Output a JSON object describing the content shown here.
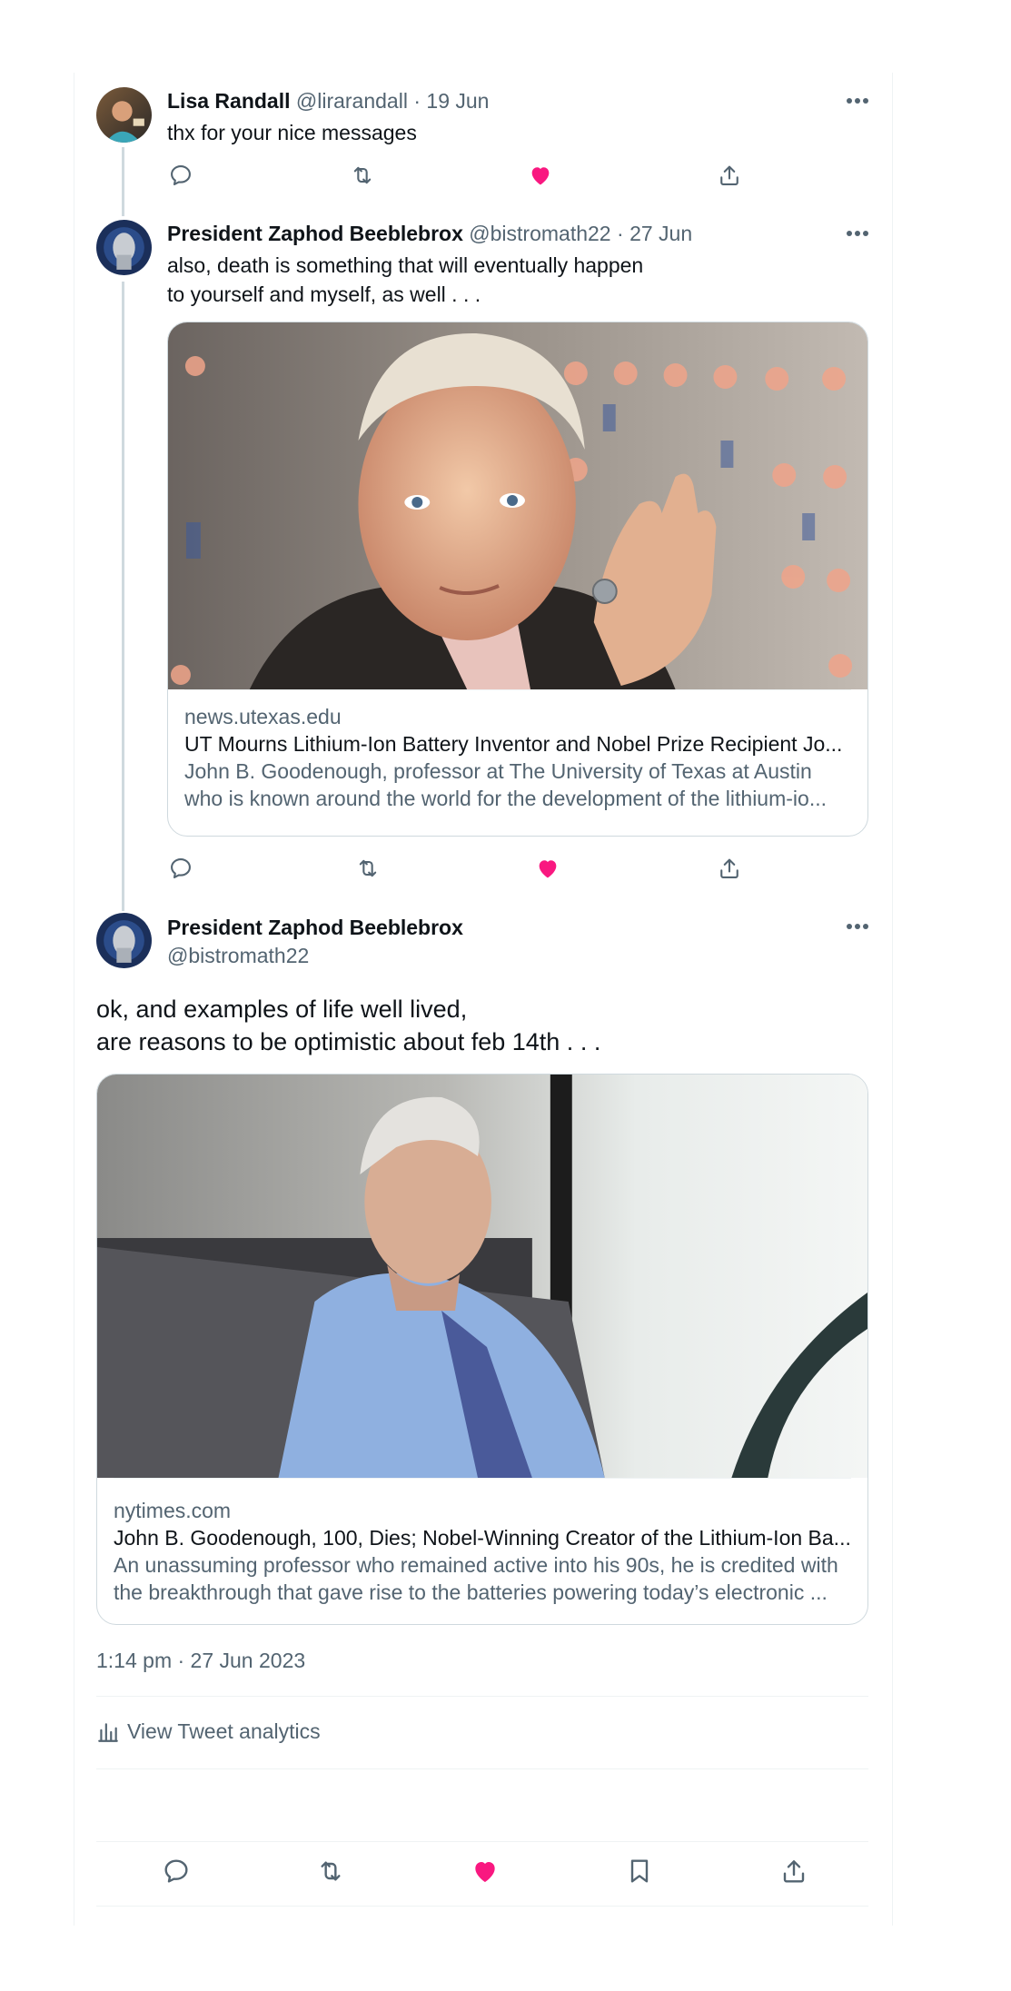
{
  "colors": {
    "like": "#f91880",
    "secondary": "#536471",
    "primary": "#0f1419",
    "border": "#cfd9de"
  },
  "tweets": [
    {
      "name": "Lisa Randall",
      "handle": "@lirarandall",
      "date": "19 Jun",
      "text_lines": [
        "thx for your nice messages"
      ]
    },
    {
      "name": "President Zaphod Beeblebrox",
      "handle": "@bistromath22",
      "date": "27 Jun",
      "text_lines": [
        "also, death is something that will eventually happen",
        "to yourself and myself, as well . . ."
      ],
      "card": {
        "domain": "news.utexas.edu",
        "title": "UT Mourns Lithium-Ion Battery Inventor and Nobel Prize Recipient Jo...",
        "desc_lines": [
          "John B. Goodenough, professor at The University of Texas at Austin",
          "who is known around the world for the development of the lithium-io..."
        ]
      }
    }
  ],
  "main_tweet": {
    "name": "President Zaphod Beeblebrox",
    "handle": "@bistromath22",
    "text_lines": [
      "ok, and examples of life well lived,",
      "are reasons to be optimistic about feb 14th . . ."
    ],
    "card": {
      "domain": "nytimes.com",
      "title": "John B. Goodenough, 100, Dies; Nobel-Winning Creator of the Lithium-Ion Ba...",
      "desc_lines": [
        "An unassuming professor who remained active into his 90s, he is credited with",
        "the breakthrough that gave rise to the batteries powering today’s electronic ..."
      ]
    },
    "timestamp": "1:14 pm · 27 Jun 2023",
    "analytics_label": "View Tweet analytics"
  },
  "icons": {
    "reply": "reply-icon",
    "retweet": "retweet-icon",
    "like": "like-icon",
    "bookmark": "bookmark-icon",
    "share": "share-icon",
    "more": "more-icon",
    "analytics": "analytics-icon"
  }
}
